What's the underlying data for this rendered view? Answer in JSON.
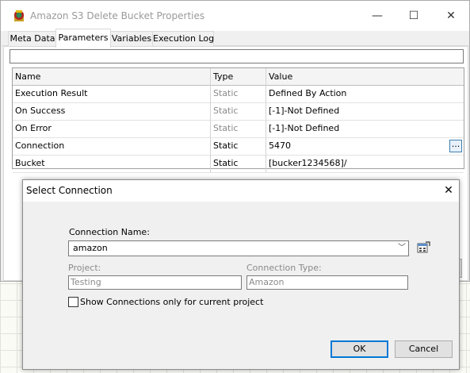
{
  "window": {
    "title": "Amazon S3 Delete Bucket Properties",
    "controls": {
      "minimize": "—",
      "maximize": "☐",
      "close": "✕"
    }
  },
  "tabs": [
    {
      "label": "Meta Data",
      "active": false
    },
    {
      "label": "Parameters",
      "active": true
    },
    {
      "label": "Variables",
      "active": false
    },
    {
      "label": "Execution Log",
      "active": false
    }
  ],
  "filter": {
    "value": ""
  },
  "grid": {
    "columns": [
      "Name",
      "Type",
      "Value"
    ],
    "rows": [
      {
        "name": "Execution Result",
        "type": "Static",
        "value": "Defined By Action"
      },
      {
        "name": "On Success",
        "type": "Static",
        "value": "[-1]-Not Defined"
      },
      {
        "name": "On Error",
        "type": "Static",
        "value": "[-1]-Not Defined"
      },
      {
        "name": "Connection",
        "type": "Static",
        "value": "5470",
        "button": "..."
      },
      {
        "name": "Bucket",
        "type": "Static",
        "value": "[bucker1234568]/"
      }
    ]
  },
  "dialog": {
    "title": "Select Connection",
    "close": "✕",
    "connection_name_label": "Connection Name:",
    "connection_name_value": "amazon",
    "chevron": "﹀",
    "project_label": "Project:",
    "project_value": "Testing",
    "connection_type_label": "Connection Type:",
    "connection_type_value": "Amazon",
    "checkbox_label": "Show Connections only for current project",
    "checkbox_checked": false,
    "ok_label": "OK",
    "cancel_label": "Cancel"
  },
  "icons": {
    "app": "app-logo-icon",
    "browse": "browse-connection-icon"
  },
  "colors": {
    "accent": "#0078d7",
    "muted_text": "#8a8a8a"
  }
}
